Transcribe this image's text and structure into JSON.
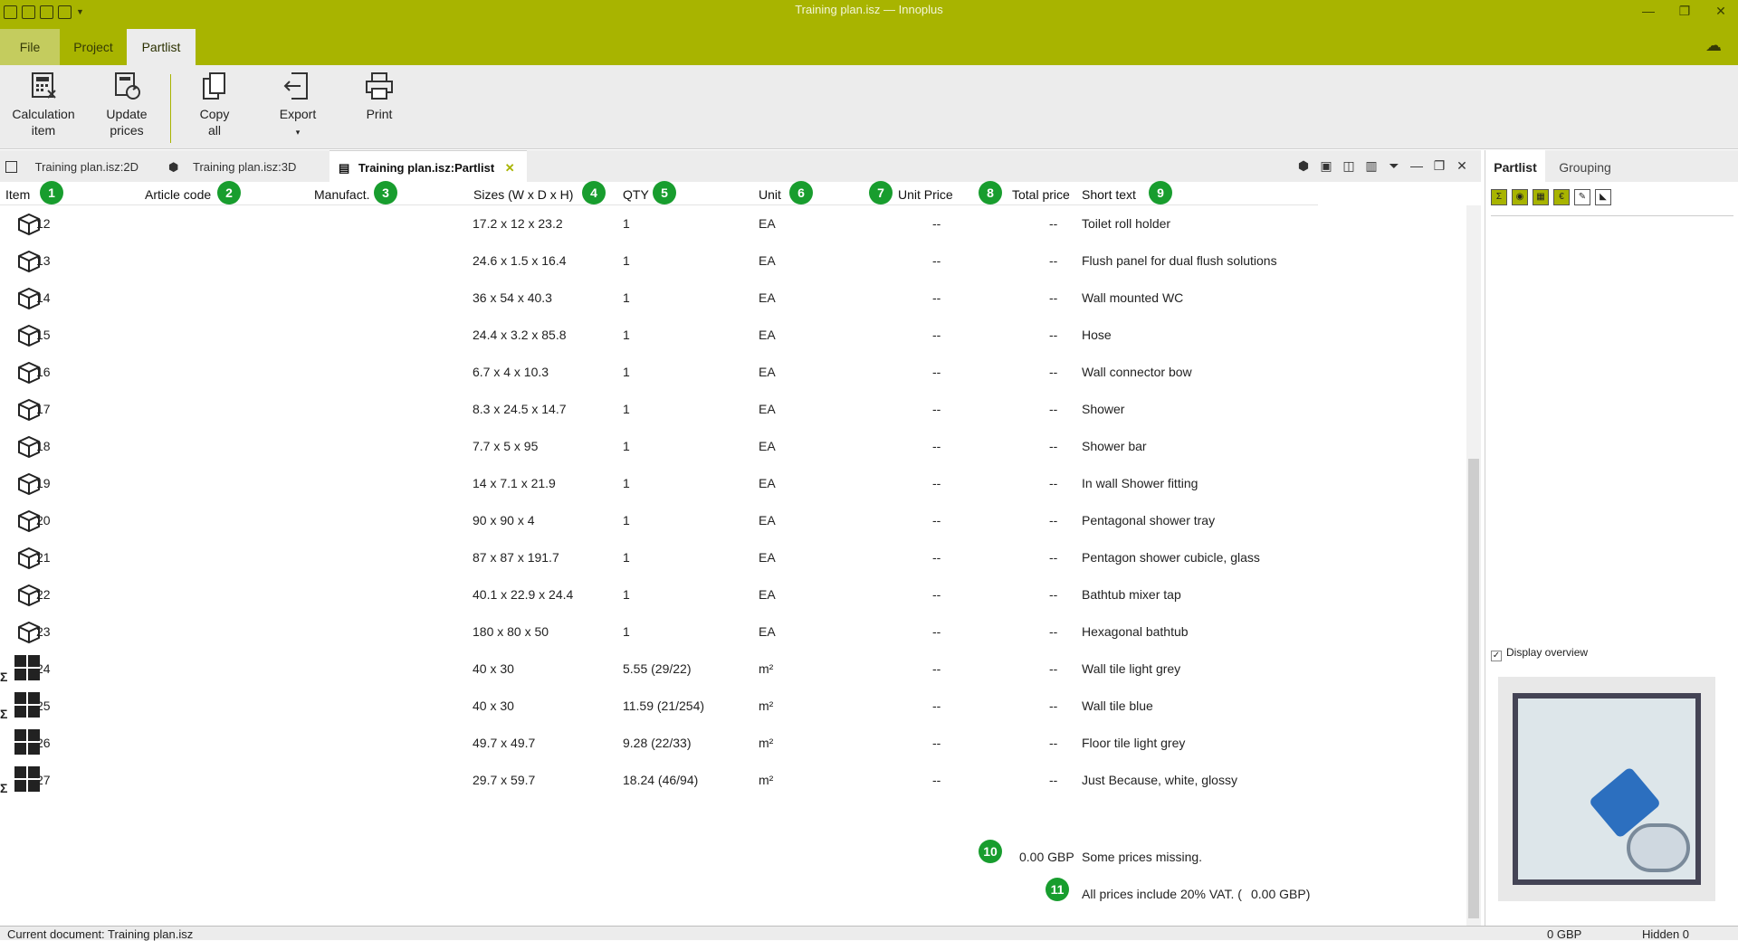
{
  "window": {
    "title": "Training plan.isz — Innoplus",
    "controls": [
      "—",
      "❐",
      "✕"
    ]
  },
  "ribbon_tabs": [
    "File",
    "Project",
    "Partlist"
  ],
  "ribbon_buttons": [
    {
      "line1": "Calculation",
      "line2": "item",
      "icon": "calculator-icon"
    },
    {
      "line1": "Update",
      "line2": "prices",
      "icon": "refresh-prices-icon"
    },
    {
      "line1": "Copy",
      "line2": "all",
      "icon": "copy-icon"
    },
    {
      "line1": "Export",
      "line2": "▾",
      "icon": "export-icon"
    },
    {
      "line1": "Print",
      "line2": "",
      "icon": "printer-icon"
    }
  ],
  "doc_tabs": [
    "Training plan.isz:2D",
    "Training plan.isz:3D",
    "Training plan.isz:Partlist"
  ],
  "columns": [
    "Item",
    "Article code",
    "Manufact.",
    "Sizes (W x D x H)",
    "QTY",
    "Unit",
    "Unit Price",
    "Total price",
    "Short text"
  ],
  "badges": [
    "1",
    "2",
    "3",
    "4",
    "5",
    "6",
    "7",
    "8",
    "9",
    "10",
    "11"
  ],
  "rows": [
    {
      "type": "cube",
      "item": "12",
      "sizes": "17.2 x 12 x 23.2",
      "qty": "1",
      "unit": "EA",
      "unit_price": "--",
      "total": "--",
      "text": "Toilet roll holder"
    },
    {
      "type": "cube",
      "item": "13",
      "sizes": "24.6 x 1.5 x 16.4",
      "qty": "1",
      "unit": "EA",
      "unit_price": "--",
      "total": "--",
      "text": "Flush panel for dual flush solutions"
    },
    {
      "type": "cube",
      "item": "14",
      "sizes": "36 x 54 x 40.3",
      "qty": "1",
      "unit": "EA",
      "unit_price": "--",
      "total": "--",
      "text": "Wall mounted WC"
    },
    {
      "type": "cube",
      "item": "15",
      "sizes": "24.4 x 3.2 x 85.8",
      "qty": "1",
      "unit": "EA",
      "unit_price": "--",
      "total": "--",
      "text": "Hose"
    },
    {
      "type": "cube",
      "item": "16",
      "sizes": "6.7 x 4 x 10.3",
      "qty": "1",
      "unit": "EA",
      "unit_price": "--",
      "total": "--",
      "text": "Wall connector bow"
    },
    {
      "type": "cube",
      "item": "17",
      "sizes": "8.3 x 24.5 x 14.7",
      "qty": "1",
      "unit": "EA",
      "unit_price": "--",
      "total": "--",
      "text": "Shower"
    },
    {
      "type": "cube",
      "item": "18",
      "sizes": "7.7 x 5 x 95",
      "qty": "1",
      "unit": "EA",
      "unit_price": "--",
      "total": "--",
      "text": "Shower bar"
    },
    {
      "type": "cube",
      "item": "19",
      "sizes": "14 x 7.1 x 21.9",
      "qty": "1",
      "unit": "EA",
      "unit_price": "--",
      "total": "--",
      "text": "In wall Shower fitting"
    },
    {
      "type": "cube",
      "item": "20",
      "sizes": "90 x 90 x 4",
      "qty": "1",
      "unit": "EA",
      "unit_price": "--",
      "total": "--",
      "text": "Pentagonal shower tray"
    },
    {
      "type": "cube",
      "item": "21",
      "sizes": "87 x 87 x 191.7",
      "qty": "1",
      "unit": "EA",
      "unit_price": "--",
      "total": "--",
      "text": "Pentagon shower cubicle, glass"
    },
    {
      "type": "cube",
      "item": "22",
      "sizes": "40.1 x 22.9 x 24.4",
      "qty": "1",
      "unit": "EA",
      "unit_price": "--",
      "total": "--",
      "text": "Bathtub mixer tap"
    },
    {
      "type": "cube",
      "item": "23",
      "sizes": "180 x 80 x 50",
      "qty": "1",
      "unit": "EA",
      "unit_price": "--",
      "total": "--",
      "text": "Hexagonal bathtub"
    },
    {
      "type": "sigma-tiles",
      "item": "24",
      "sizes": "40 x 30",
      "qty": "5.55 (29/22)",
      "unit": "m²",
      "unit_price": "--",
      "total": "--",
      "text": "Wall tile light grey"
    },
    {
      "type": "sigma-tiles",
      "item": "25",
      "sizes": "40 x 30",
      "qty": "11.59 (21/254)",
      "unit": "m²",
      "unit_price": "--",
      "total": "--",
      "text": "Wall tile blue"
    },
    {
      "type": "tiles",
      "item": "26",
      "sizes": "49.7 x 49.7",
      "qty": "9.28 (22/33)",
      "unit": "m²",
      "unit_price": "--",
      "total": "--",
      "text": "Floor tile light grey"
    },
    {
      "type": "sigma-tiles",
      "item": "27",
      "sizes": "29.7 x 59.7",
      "qty": "18.24 (46/94)",
      "unit": "m²",
      "unit_price": "--",
      "total": "--",
      "text": "Just Because, white, glossy"
    }
  ],
  "footer": {
    "total": "0.00 GBP",
    "missing": "Some prices missing.",
    "vat": "All prices include 20% VAT. (",
    "vat_amount": "0.00 GBP)"
  },
  "side": {
    "tabs": [
      "Partlist",
      "Grouping"
    ],
    "display_overview": "Display overview",
    "checked": true
  },
  "status": {
    "document": "Current document: Training plan.isz",
    "currency": "0  GBP",
    "hidden": "Hidden 0"
  },
  "colors": {
    "accent": "#a8b400",
    "badge": "#189d2e"
  }
}
